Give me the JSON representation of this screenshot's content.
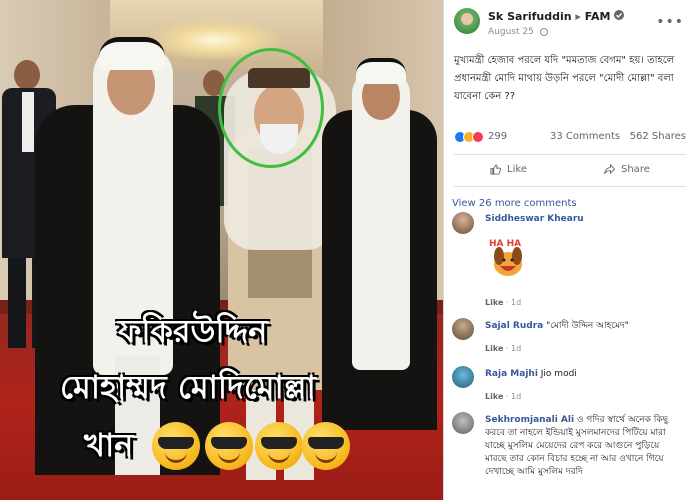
{
  "photo": {
    "caption_line1": "ফকিরউদ্দিন",
    "caption_line2": "মোহাম্মদ মোদিমোল্লা",
    "caption_line3": "খান",
    "emoji_name": "smiling-face-with-sunglasses",
    "highlight_circle_color": "#3fbf3f"
  },
  "post": {
    "author": "Sk Sarifuddin",
    "arrow": "▸",
    "group": "FAM",
    "date": "August 25",
    "text": "মুখ্যমন্ত্রী হেজাব পরলে যদি \"মমতাজ বেগম\" হয়। তাহলে প্রধানমন্ত্রী মোদি মাথায় উড়নি পরলে \"মোদী মোল্লা\" বলা যাবেনা কেন ??",
    "reaction_count": "299",
    "comments_count": "33 Comments",
    "shares_count": "562 Shares",
    "like_label": "Like",
    "share_label": "Share",
    "view_more": "View 26 more comments",
    "more_icon": "ellipsis-icon"
  },
  "comments": [
    {
      "name": "Siddheswar Khearu",
      "text": "",
      "like": "Like",
      "age": "1d",
      "sticker_text": "HA HA"
    },
    {
      "name": "Sajal Rudra",
      "text": "\"মোদী উদ্দিন আহমেদ\"",
      "like": "Like",
      "age": "1d"
    },
    {
      "name": "Raja Majhi",
      "text": "Jio modi",
      "like": "Like",
      "age": "1d"
    },
    {
      "name": "Sekhromjanali Ali",
      "text": "ও গদির স্বার্থে অনেক কিছু করবে তা নাহলে ইন্ডিয়াই মুসলমানদের পিটিয়ে মারা যাচ্ছে মুসলিম মেয়েদের রেপ করে আগুনে পুড়িয়ে মারছে তার কোন বিচার হচ্ছে না আর ওখানে গিয়ে দেখাচ্ছে আমি মুসলিম দরদি",
      "like": "",
      "age": ""
    }
  ],
  "colors": {
    "link_blue": "#385898",
    "like_blue": "#1877f2",
    "haha_yellow": "#f7b125",
    "love_red": "#f33e58",
    "muted_gray": "#606770"
  }
}
